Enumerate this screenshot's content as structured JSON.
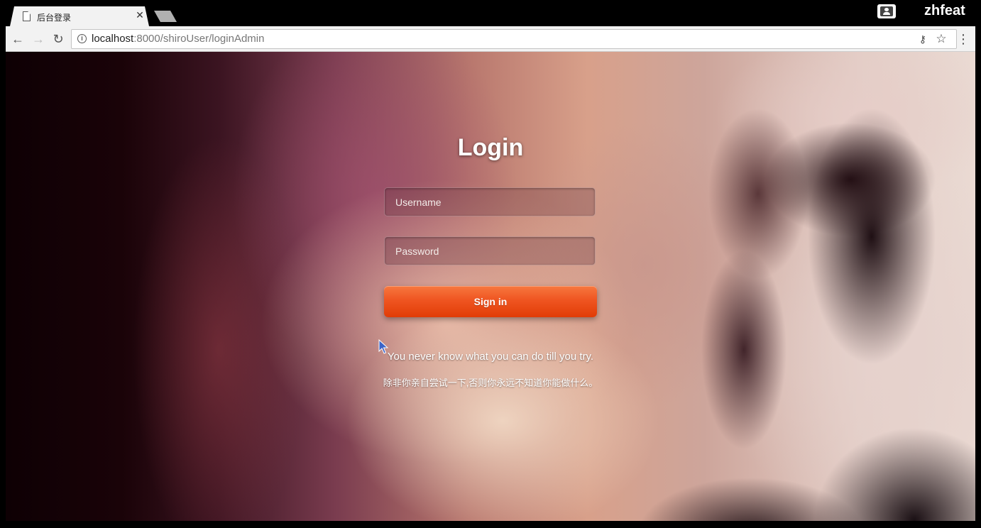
{
  "browser": {
    "tab_title": "后台登录",
    "tab_close": "✕",
    "profile_name": "zhfeat",
    "back_symbol": "←",
    "forward_symbol": "→",
    "reload_symbol": "↻",
    "url_host": "localhost",
    "url_rest": ":8000/shiroUser/loginAdmin",
    "info_symbol": "i",
    "key_symbol": "⚷",
    "star_symbol": "☆",
    "menu_symbol": "⋮"
  },
  "page": {
    "title": "Login",
    "username_placeholder": "Username",
    "password_placeholder": "Password",
    "signin_label": "Sign in",
    "quote_en": "You never know what you can do till you try.",
    "quote_cn": "除非你亲自尝试一下,否则你永远不知道你能做什么。"
  },
  "icons": {
    "tab_page": "page-icon",
    "profile": "profile-icon",
    "cursor": "mouse-pointer-icon"
  },
  "colors": {
    "signin_button": "#ef5521",
    "chrome_bar": "#f2f2f2"
  }
}
